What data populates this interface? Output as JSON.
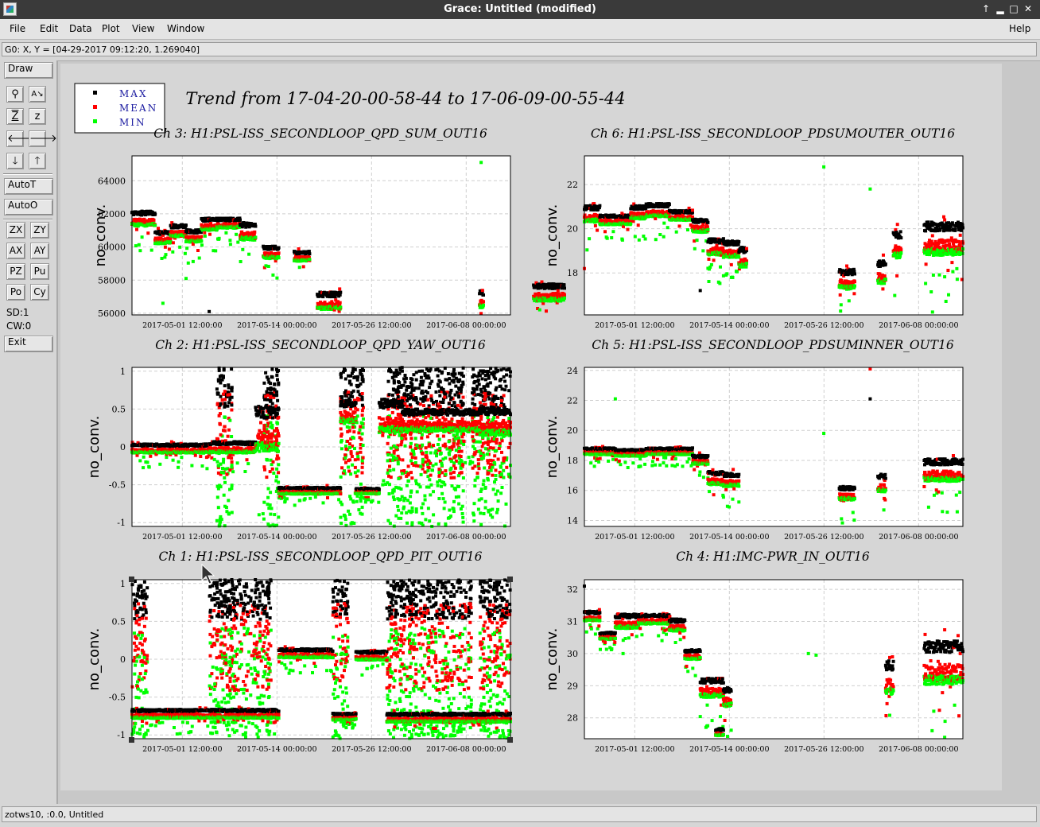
{
  "window": {
    "title": "Grace: Untitled (modified)"
  },
  "menu": {
    "file": "File",
    "edit": "Edit",
    "data": "Data",
    "plot": "Plot",
    "view": "View",
    "window": "Window",
    "help": "Help"
  },
  "locator": "G0: X, Y = [04-29-2017 09:12:20, 1.269040]",
  "toolbar": {
    "draw": "Draw",
    "zoom_icons": [
      "zoom-icon",
      "autoscale-text-icon",
      "zoom-z-icon",
      "zoom-z-alt-icon"
    ],
    "arrow_icons": [
      "arrow-left-icon",
      "arrow-right-icon",
      "arrow-down-icon",
      "arrow-up-icon"
    ],
    "autot": "AutoT",
    "autoo": "AutoO",
    "small": [
      "ZX",
      "ZY",
      "AX",
      "AY",
      "PZ",
      "Pu",
      "Po",
      "Cy"
    ],
    "sd": "SD:1",
    "cw": "CW:0",
    "exit": "Exit"
  },
  "status": "zotws10, :0.0, Untitled",
  "legend": [
    {
      "label": "MAX",
      "color": "#000000"
    },
    {
      "label": "MEAN",
      "color": "#ff0000"
    },
    {
      "label": "MIN",
      "color": "#00ff00"
    }
  ],
  "main_title": "Trend from 17-04-20-00-58-44 to 17-06-09-00-55-44",
  "chart_data": [
    {
      "type": "scatter",
      "title": "Ch 3: H1:PSL-ISS_SECONDLOOP_QPD_SUM_OUT16",
      "ylabel": "no_conv.",
      "x_ticks": [
        "2017-05-01 12:00:00",
        "2017-05-14 00:00:00",
        "2017-05-26 12:00:00",
        "2017-06-08 00:00:00"
      ],
      "y_ticks": [
        "56000",
        "58000",
        "60000",
        "62000",
        "64000"
      ],
      "ylim": [
        55900,
        65500
      ],
      "segments": [
        [
          0,
          3,
          61500,
          600
        ],
        [
          3,
          5,
          60400,
          500
        ],
        [
          5,
          7,
          60800,
          500
        ],
        [
          7,
          9,
          60500,
          500
        ],
        [
          9,
          11,
          61200,
          500
        ],
        [
          11,
          14,
          61300,
          400
        ],
        [
          14,
          16,
          60700,
          700
        ],
        [
          17,
          19,
          59500,
          500
        ],
        [
          21,
          23,
          59300,
          400
        ],
        [
          24,
          27,
          56500,
          700
        ],
        [
          45,
          45.5,
          56600,
          700
        ],
        [
          52,
          56,
          57000,
          700
        ]
      ],
      "outliers": [
        [
          45.2,
          65100,
          "min"
        ],
        [
          4,
          56600,
          "min"
        ],
        [
          7,
          58100,
          "min"
        ],
        [
          10,
          56100,
          "max"
        ]
      ]
    },
    {
      "type": "scatter",
      "title": "Ch 6: H1:PSL-ISS_SECONDLOOP_PDSUMOUTER_OUT16",
      "ylabel": "no_conv.",
      "x_ticks": [
        "2017-05-01 12:00:00",
        "2017-05-14 00:00:00",
        "2017-05-26 12:00:00",
        "2017-06-08 00:00:00"
      ],
      "y_ticks": [
        "18",
        "20",
        "22"
      ],
      "ylim": [
        16.1,
        23.3
      ],
      "segments": [
        [
          0,
          2,
          20.5,
          0.5
        ],
        [
          2,
          6,
          20.3,
          0.3
        ],
        [
          6,
          8,
          20.6,
          0.4
        ],
        [
          8,
          11,
          20.7,
          0.4
        ],
        [
          11,
          14,
          20.5,
          0.3
        ],
        [
          14,
          16,
          20.0,
          0.4
        ],
        [
          16,
          18,
          19.0,
          0.5
        ],
        [
          18,
          20,
          18.9,
          0.5
        ],
        [
          20,
          21,
          18.5,
          0.6
        ],
        [
          33,
          35,
          17.5,
          0.6
        ],
        [
          38,
          39,
          17.8,
          0.7
        ],
        [
          40,
          41,
          19.0,
          0.8
        ],
        [
          44,
          49,
          19.2,
          1.0
        ]
      ],
      "outliers": [
        [
          31,
          22.8,
          "min"
        ],
        [
          37,
          21.8,
          "min"
        ],
        [
          0,
          18.2,
          "mean"
        ],
        [
          15,
          17.2,
          "max"
        ]
      ]
    },
    {
      "type": "scatter",
      "title": "Ch 2: H1:PSL-ISS_SECONDLOOP_QPD_YAW_OUT16",
      "ylabel": "no_conv.",
      "x_ticks": [
        "2017-05-01 12:00:00",
        "2017-05-14 00:00:00",
        "2017-05-26 12:00:00",
        "2017-06-08 00:00:00"
      ],
      "y_ticks": [
        "-1",
        "-0.5",
        "0",
        "0.5",
        "1"
      ],
      "ylim": [
        -1.05,
        1.05
      ],
      "segments": [
        [
          0,
          10,
          -0.05,
          0.08
        ],
        [
          10,
          16,
          -0.04,
          0.1
        ],
        [
          16,
          19,
          0.1,
          0.4
        ],
        [
          19,
          27,
          -0.6,
          0.06
        ],
        [
          27,
          29,
          0.4,
          0.2
        ],
        [
          29,
          32,
          -0.6,
          0.05
        ],
        [
          32,
          35,
          0.3,
          0.3
        ],
        [
          35,
          45,
          0.28,
          0.2
        ],
        [
          45,
          49,
          0.25,
          0.25
        ]
      ],
      "spread": [
        [
          11,
          13
        ],
        [
          17,
          19
        ],
        [
          27,
          30
        ],
        [
          33,
          43
        ],
        [
          44,
          49
        ]
      ]
    },
    {
      "type": "scatter",
      "title": "Ch 5: H1:PSL-ISS_SECONDLOOP_PDSUMINNER_OUT16",
      "ylabel": "no_conv.",
      "x_ticks": [
        "2017-05-01 12:00:00",
        "2017-05-14 00:00:00",
        "2017-05-26 12:00:00",
        "2017-06-08 00:00:00"
      ],
      "y_ticks": [
        "14",
        "16",
        "18",
        "20",
        "22",
        "24"
      ],
      "ylim": [
        13.6,
        24.2
      ],
      "segments": [
        [
          0,
          4,
          18.5,
          0.3
        ],
        [
          4,
          8,
          18.4,
          0.3
        ],
        [
          8,
          14,
          18.5,
          0.3
        ],
        [
          14,
          16,
          17.9,
          0.4
        ],
        [
          16,
          18,
          16.6,
          0.6
        ],
        [
          18,
          20,
          16.5,
          0.6
        ],
        [
          33,
          35,
          15.6,
          0.6
        ],
        [
          38,
          39,
          16.2,
          0.8
        ],
        [
          44,
          49,
          17.0,
          1.0
        ]
      ],
      "outliers": [
        [
          37,
          24.1,
          "mean"
        ],
        [
          37,
          22.1,
          "max"
        ],
        [
          4,
          22.1,
          "min"
        ],
        [
          31,
          19.8,
          "min"
        ]
      ]
    },
    {
      "type": "scatter",
      "title": "Ch 1: H1:PSL-ISS_SECONDLOOP_QPD_PIT_OUT16",
      "ylabel": "no_conv.",
      "x_ticks": [
        "2017-05-01 12:00:00",
        "2017-05-14 00:00:00",
        "2017-05-26 12:00:00",
        "2017-06-08 00:00:00"
      ],
      "y_ticks": [
        "-1",
        "-0.5",
        "0",
        "0.5",
        "1"
      ],
      "ylim": [
        -1.05,
        1.05
      ],
      "segments": [
        [
          0,
          19,
          -0.75,
          0.08
        ],
        [
          19,
          26,
          0.05,
          0.08
        ],
        [
          26,
          29,
          -0.78,
          0.06
        ],
        [
          29,
          33,
          0.02,
          0.08
        ],
        [
          33,
          49,
          -0.8,
          0.08
        ]
      ],
      "spread": [
        [
          0,
          2
        ],
        [
          10,
          18
        ],
        [
          26,
          28
        ],
        [
          33,
          44
        ],
        [
          45,
          49
        ]
      ]
    },
    {
      "type": "scatter",
      "title": "Ch 4: H1:IMC-PWR_IN_OUT16",
      "ylabel": "no_conv.",
      "x_ticks": [
        "2017-05-01 12:00:00",
        "2017-05-14 00:00:00",
        "2017-05-26 12:00:00",
        "2017-06-08 00:00:00"
      ],
      "y_ticks": [
        "28",
        "29",
        "30",
        "31",
        "32"
      ],
      "ylim": [
        27.35,
        32.3
      ],
      "segments": [
        [
          0,
          2,
          31.1,
          0.2
        ],
        [
          2,
          4,
          30.5,
          0.15
        ],
        [
          4,
          7,
          30.9,
          0.3
        ],
        [
          7,
          11,
          31.0,
          0.2
        ],
        [
          11,
          13,
          30.8,
          0.25
        ],
        [
          13,
          15,
          29.9,
          0.2
        ],
        [
          15,
          18,
          28.8,
          0.4
        ],
        [
          18,
          19,
          28.5,
          0.4
        ],
        [
          17,
          18,
          27.5,
          0.15
        ],
        [
          39,
          40,
          29.0,
          0.7
        ],
        [
          44,
          49,
          29.4,
          0.9
        ]
      ],
      "outliers": [
        [
          29,
          30.0,
          "min"
        ],
        [
          30,
          29.95,
          "min"
        ],
        [
          0,
          32.1,
          "max"
        ],
        [
          5,
          30.0,
          "min"
        ]
      ]
    }
  ]
}
